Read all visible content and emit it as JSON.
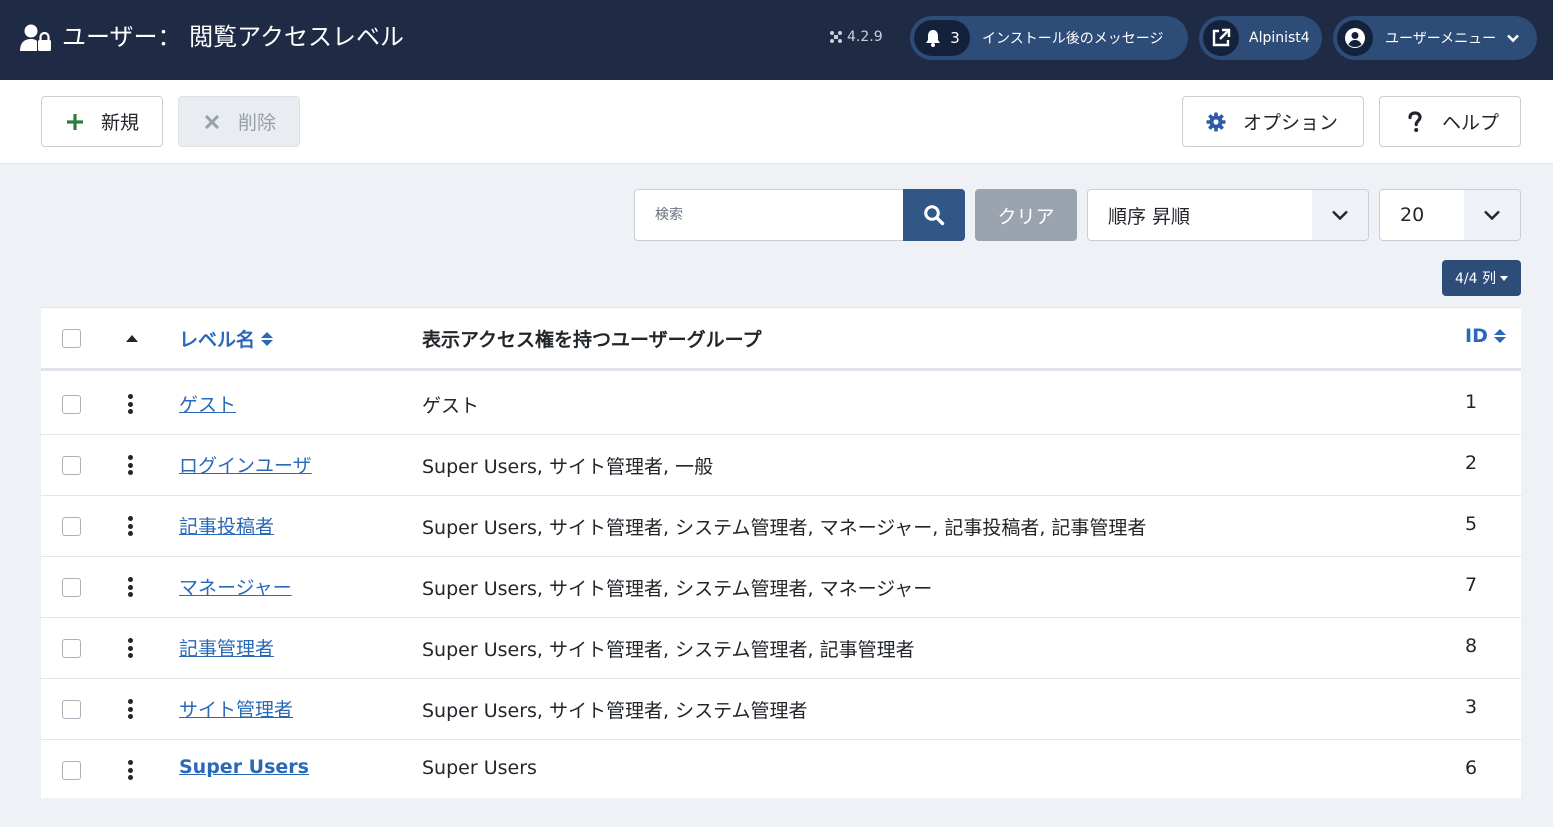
{
  "header": {
    "title": "ユーザー： 閲覧アクセスレベル",
    "version": "4.2.9",
    "messages_count": "3",
    "messages_label": "インストール後のメッセージ",
    "site_label": "Alpinist4",
    "user_menu_label": "ユーザーメニュー"
  },
  "toolbar": {
    "new_label": "新規",
    "delete_label": "削除",
    "options_label": "オプション",
    "help_label": "ヘルプ"
  },
  "filters": {
    "search_placeholder": "検索",
    "clear_label": "クリア",
    "order_value": "順序 昇順",
    "limit_value": "20",
    "columns_label": "4/4 列"
  },
  "table": {
    "headers": {
      "name": "レベル名",
      "groups": "表示アクセス権を持つユーザーグループ",
      "id": "ID"
    },
    "rows": [
      {
        "name": "ゲスト",
        "groups": "ゲスト",
        "id": "1"
      },
      {
        "name": "ログインユーザ",
        "groups": "Super Users, サイト管理者, 一般",
        "id": "2"
      },
      {
        "name": "記事投稿者",
        "groups": "Super Users, サイト管理者, システム管理者, マネージャー, 記事投稿者, 記事管理者",
        "id": "5"
      },
      {
        "name": "マネージャー",
        "groups": "Super Users, サイト管理者, システム管理者, マネージャー",
        "id": "7"
      },
      {
        "name": "記事管理者",
        "groups": "Super Users, サイト管理者, システム管理者, 記事管理者",
        "id": "8"
      },
      {
        "name": "サイト管理者",
        "groups": "Super Users, サイト管理者, システム管理者",
        "id": "3"
      },
      {
        "name": "Super Users",
        "groups": "Super Users",
        "id": "6"
      }
    ]
  },
  "colors": {
    "header_bg": "#1f2b44",
    "pill_bg": "#2e4c78",
    "link": "#2a69b8",
    "search_btn": "#305785",
    "new_icon": "#2f7d3a"
  }
}
